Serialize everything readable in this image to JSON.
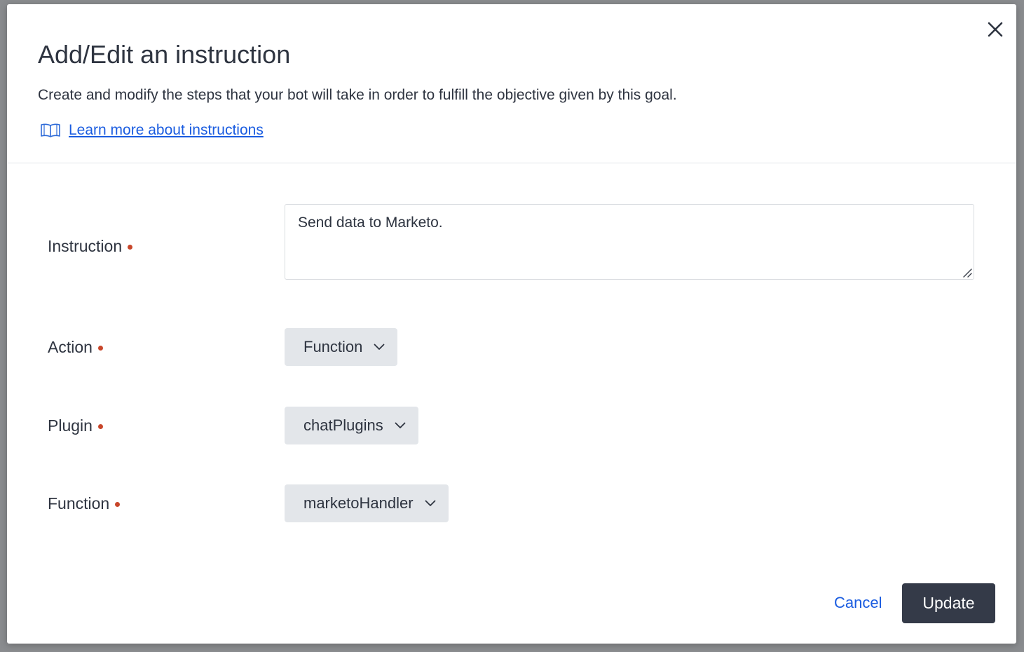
{
  "dialog": {
    "title": "Add/Edit an instruction",
    "subtitle": "Create and modify the steps that your bot will take in order to fulfill the objective given by this goal.",
    "learn_more_label": "Learn more about instructions",
    "close_icon": "close-icon"
  },
  "form": {
    "instruction": {
      "label": "Instruction",
      "value": "Send data to Marketo."
    },
    "action": {
      "label": "Action",
      "selected": "Function"
    },
    "plugin": {
      "label": "Plugin",
      "selected": "chatPlugins"
    },
    "function": {
      "label": "Function",
      "selected": "marketoHandler"
    }
  },
  "footer": {
    "cancel_label": "Cancel",
    "update_label": "Update"
  },
  "colors": {
    "primary_button": "#343a48",
    "link": "#1a5ce0",
    "required_dot": "#c8462a",
    "select_bg": "#e3e6ea"
  }
}
